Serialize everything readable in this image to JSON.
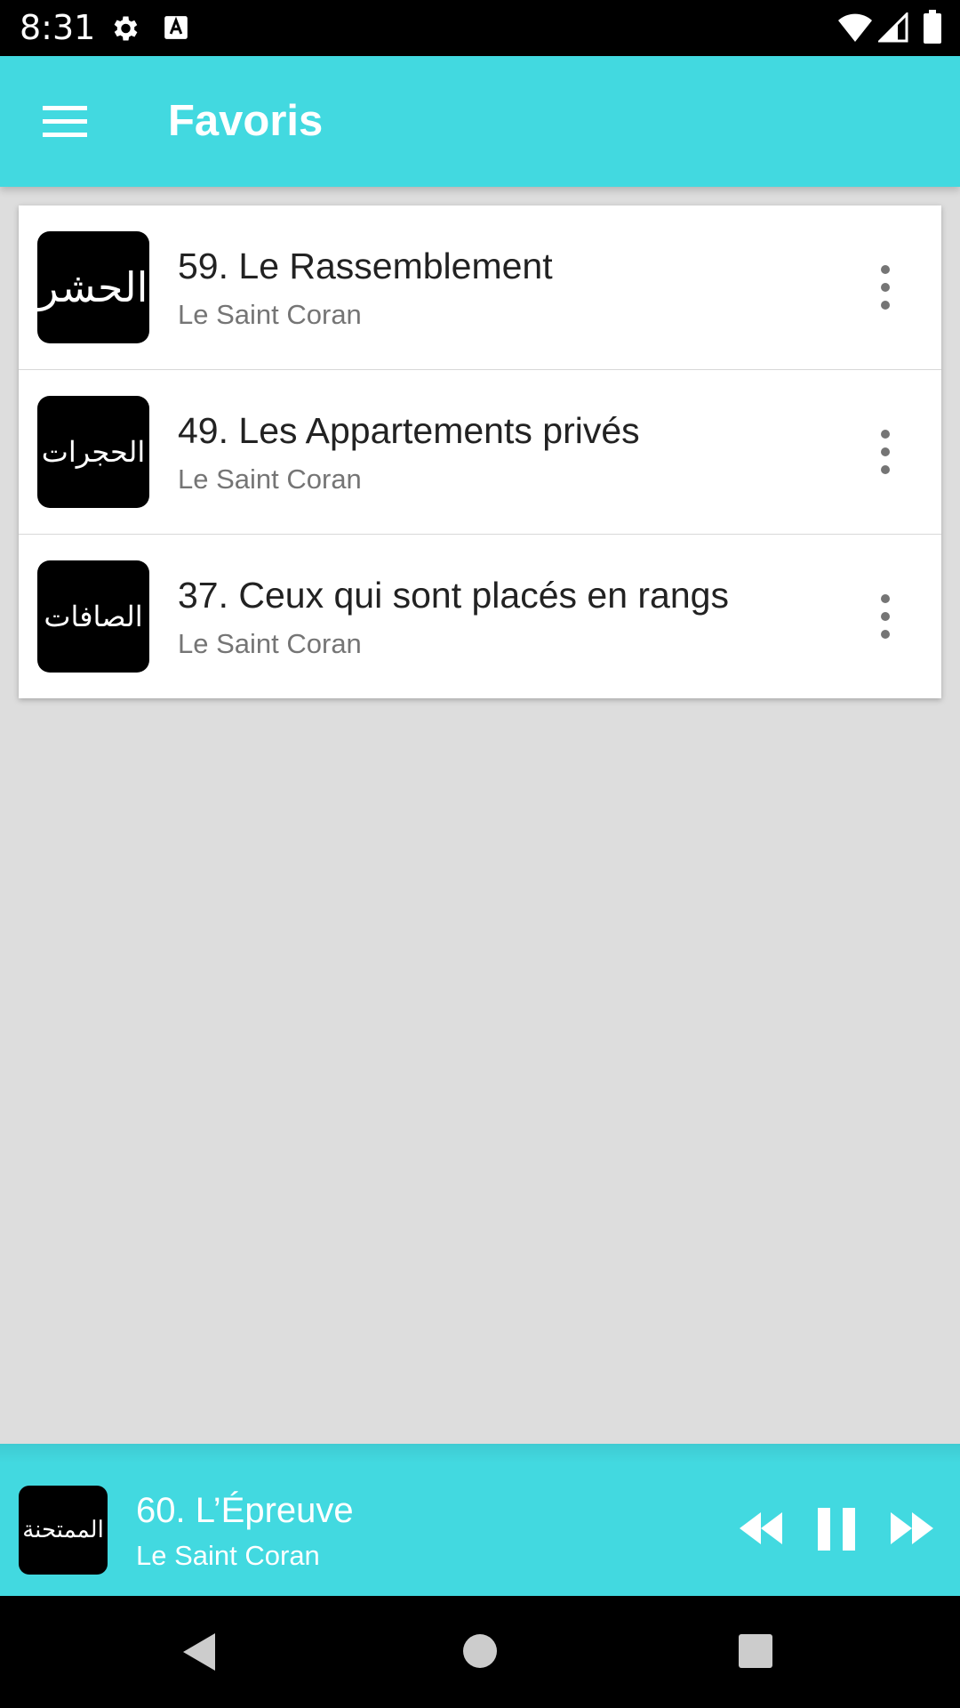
{
  "status_bar": {
    "time": "8:31",
    "icons": [
      "gear-icon",
      "a-notification-icon",
      "wifi-icon",
      "signal-icon",
      "battery-icon"
    ]
  },
  "app_bar": {
    "title": "Favoris",
    "menu_icon": "menu-icon"
  },
  "favorites": [
    {
      "thumb_text": "الحشر",
      "title": "59. Le Rassemblement",
      "subtitle": "Le Saint Coran"
    },
    {
      "thumb_text": "الحجرات",
      "title": "49. Les Appartements privés",
      "subtitle": "Le Saint Coran"
    },
    {
      "thumb_text": "الصافات",
      "title": "37. Ceux qui sont placés en rangs",
      "subtitle": "Le Saint Coran"
    }
  ],
  "player": {
    "thumb_text": "الممتحنة",
    "title": "60. L’Épreuve",
    "subtitle": "Le Saint Coran",
    "controls": [
      "rewind-icon",
      "pause-icon",
      "fast-forward-icon"
    ]
  },
  "colors": {
    "accent": "#42d9e0",
    "background": "#dddddd",
    "card": "#ffffff",
    "thumb": "#000000"
  }
}
